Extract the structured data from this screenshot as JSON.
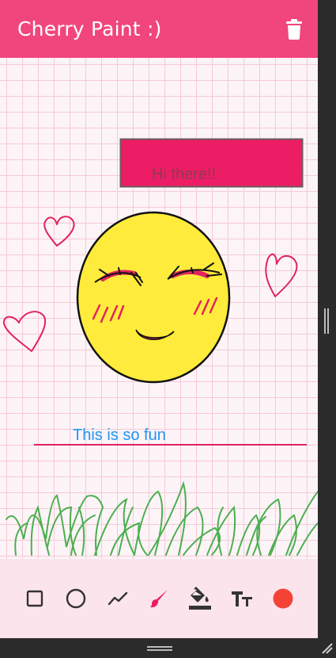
{
  "app": {
    "title": "Cherry Paint :)"
  },
  "canvas": {
    "note_text": "Hi there!!",
    "caption_text": "This is so fun"
  },
  "toolbar": {
    "tools": [
      {
        "name": "rectangle-tool",
        "icon": "square-outline-icon"
      },
      {
        "name": "circle-tool",
        "icon": "circle-outline-icon"
      },
      {
        "name": "line-tool",
        "icon": "polyline-icon"
      },
      {
        "name": "brush-tool",
        "icon": "brush-icon",
        "active": true
      },
      {
        "name": "fill-tool",
        "icon": "paint-bucket-icon"
      },
      {
        "name": "text-tool",
        "icon": "text-size-icon"
      },
      {
        "name": "color-picker",
        "icon": "color-swatch-icon"
      }
    ],
    "selected_color": "#f44336"
  },
  "colors": {
    "appbar": "#f1467b",
    "accent": "#e91e63",
    "toolbar_bg": "#fce4ec",
    "text_blue": "#2196f3"
  }
}
